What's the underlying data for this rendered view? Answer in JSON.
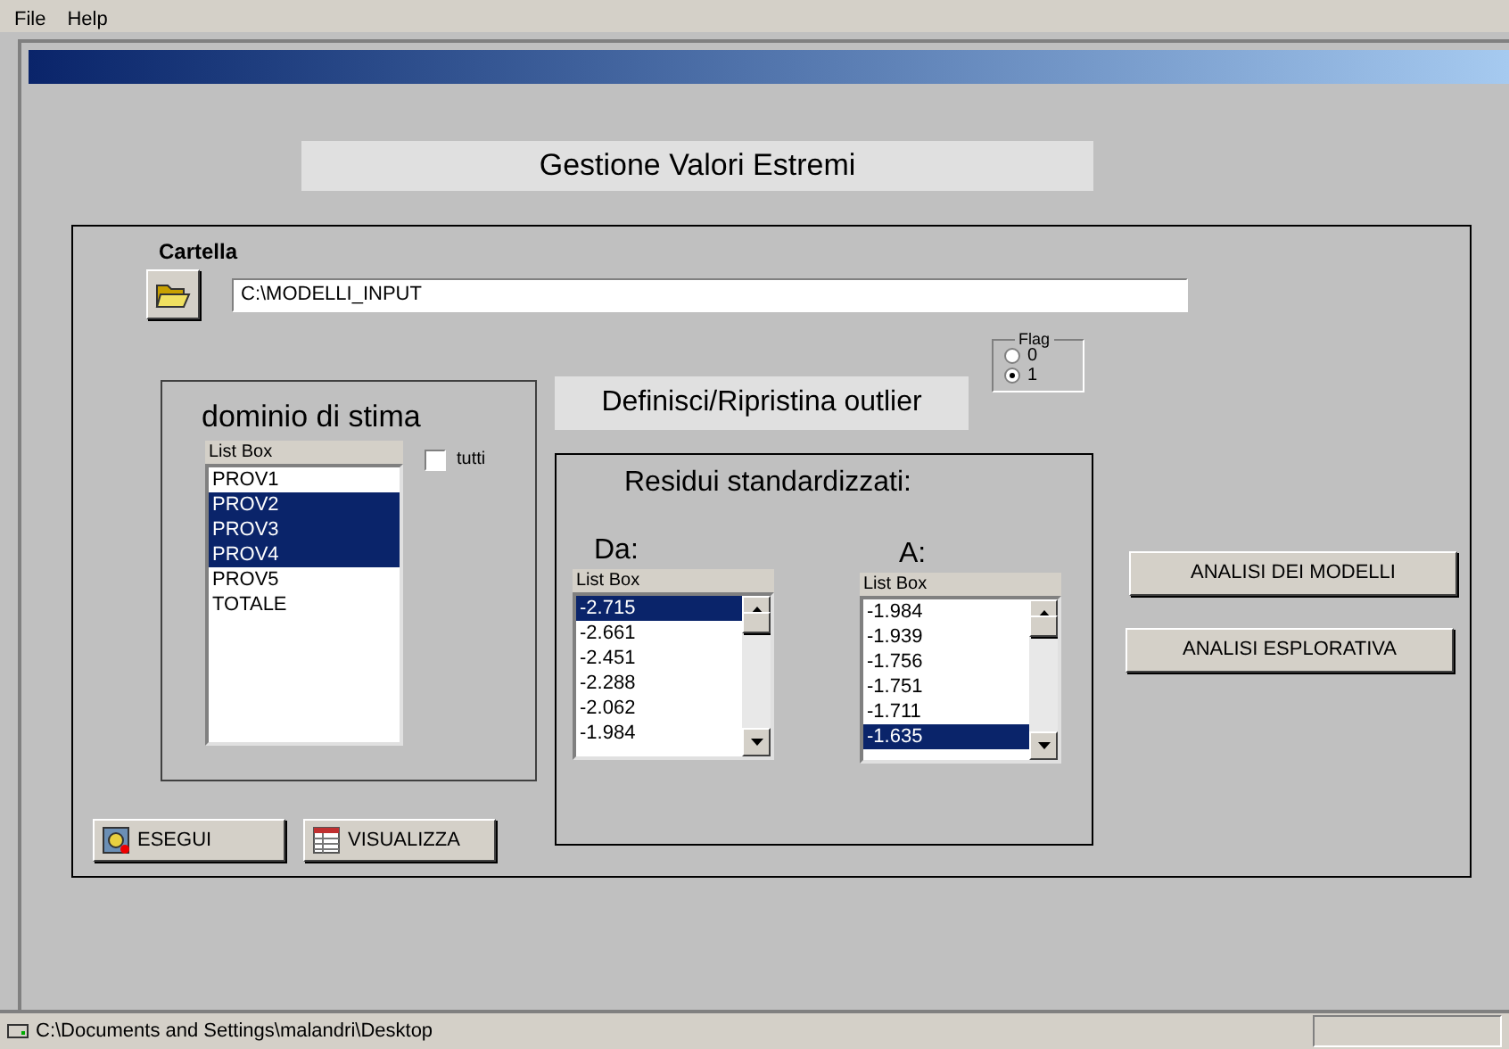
{
  "menu": [
    "File",
    "Help"
  ],
  "heading": "Gestione Valori Estremi",
  "folder": {
    "label": "Cartella",
    "path": "C:\\MODELLI_INPUT"
  },
  "domain": {
    "title": "dominio di stima",
    "caption": "List Box",
    "all": {
      "label": "tutti",
      "checked": false
    },
    "items": [
      {
        "label": "PROV1",
        "selected": false
      },
      {
        "label": "PROV2",
        "selected": true
      },
      {
        "label": "PROV3",
        "selected": true
      },
      {
        "label": "PROV4",
        "selected": true
      },
      {
        "label": "PROV5",
        "selected": false
      },
      {
        "label": "TOTALE",
        "selected": false
      }
    ]
  },
  "outlier": {
    "label": "Definisci/Ripristina outlier"
  },
  "flag": {
    "title": "Flag",
    "options": [
      {
        "label": "0",
        "selected": false
      },
      {
        "label": "1",
        "selected": true
      }
    ]
  },
  "residui": {
    "title": "Residui standardizzati:",
    "lists": [
      {
        "label": "Da:",
        "caption": "List Box",
        "items": [
          {
            "label": "-2.715",
            "selected": true
          },
          {
            "label": "-2.661",
            "selected": false
          },
          {
            "label": "-2.451",
            "selected": false
          },
          {
            "label": "-2.288",
            "selected": false
          },
          {
            "label": "-2.062",
            "selected": false
          },
          {
            "label": "-1.984",
            "selected": false
          }
        ]
      },
      {
        "label": "A:",
        "caption": "List Box",
        "items": [
          {
            "label": "-1.984",
            "selected": false
          },
          {
            "label": "-1.939",
            "selected": false
          },
          {
            "label": "-1.756",
            "selected": false
          },
          {
            "label": "-1.751",
            "selected": false
          },
          {
            "label": "-1.711",
            "selected": false
          },
          {
            "label": "-1.635",
            "selected": true
          }
        ]
      }
    ]
  },
  "side_buttons": [
    "ANALISI DEI MODELLI",
    "ANALISI ESPLORATIVA"
  ],
  "bottom_buttons": [
    {
      "label": "ESEGUI",
      "kind": "run"
    },
    {
      "label": "VISUALIZZA",
      "kind": "view"
    }
  ],
  "status_bar": "C:\\Documents and Settings\\malandri\\Desktop"
}
